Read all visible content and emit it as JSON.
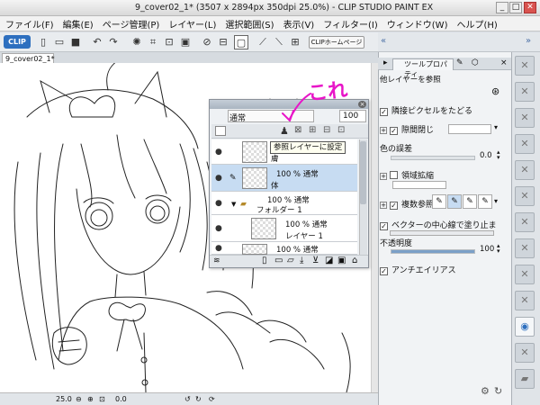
{
  "window": {
    "title": "9_cover02_1* (3507 x 2894px 350dpi 25.0%) - CLIP STUDIO PAINT EX",
    "min_btn": "_",
    "max_btn": "□",
    "close_btn": "✕"
  },
  "menu": [
    "ファイル(F)",
    "編集(E)",
    "ページ管理(P)",
    "レイヤー(L)",
    "選択範囲(S)",
    "表示(V)",
    "フィルター(I)",
    "ウィンドウ(W)",
    "ヘルプ(H)"
  ],
  "toolbar": {
    "logo_label": "CLIP",
    "home_label": "CLIPホームページ"
  },
  "document": {
    "tab_label": "9_cover02_1*"
  },
  "status": {
    "zoom": "25.0",
    "rotation": "0.0"
  },
  "layer_panel": {
    "blend_mode": "通常",
    "opacity": "100",
    "tooltip": "参照レイヤーに設定",
    "layers": [
      {
        "line1": "",
        "line2": "膚"
      },
      {
        "line1": "100 % 通常",
        "line2": "体"
      },
      {
        "line1": "100 % 通常",
        "line2": "フォルダー 1"
      },
      {
        "line1": "100 % 通常",
        "line2": "レイヤー 1"
      },
      {
        "line1": "100 % 通常",
        "line2": ""
      }
    ]
  },
  "annotation": {
    "text": "これ",
    "color": "#e815c8"
  },
  "tool_property": {
    "tab_label": "ツールプロパティ",
    "subtitle": "他レイヤーを参照",
    "rows": {
      "trace_pixels": "隣接ピクセルをたどる",
      "gap_close": "隙間閉じ",
      "color_margin": "色の誤差",
      "color_margin_value": "0.0",
      "area_scaling": "領域拡縮",
      "multi_ref": "複数参照",
      "vector_center": "ベクターの中心線で塗り止ま",
      "opacity_label": "不透明度",
      "opacity_value": "100",
      "antialias": "アンチエイリアス"
    },
    "levels": {
      "color_margin": 0.0,
      "opacity": 1.0
    }
  }
}
